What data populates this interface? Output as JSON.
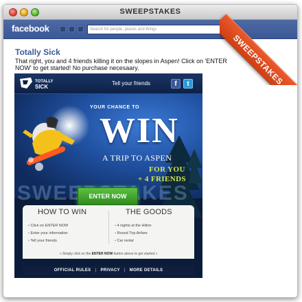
{
  "window": {
    "title": "SWEEPSTAKES"
  },
  "ribbon": {
    "label": "SWEEPSTAKES"
  },
  "facebook": {
    "logo": "facebook",
    "search_placeholder": "Search for people, places and things"
  },
  "page": {
    "title": "Totally Sick",
    "description": "That right, you and 4 friends killing it on the slopes in Aspen! Click on 'ENTER NOW' to get started! No purchase necesaary."
  },
  "app": {
    "logo": "TOTALLY SICK",
    "tell_friends": "Tell your friends",
    "share": {
      "facebook": "f",
      "twitter": "t"
    },
    "hero": {
      "chance": "YOUR CHANCE TO",
      "win": "WIN",
      "trip": "A TRIP TO ASPEN",
      "for_you": "FOR YOU",
      "friends": "+ 4 FRIENDS",
      "ghost_text": "SWEEPSTAKES"
    },
    "enter_button": "ENTER NOW",
    "how_to_win": {
      "title": "HOW TO WIN",
      "items": [
        "Click on ENTER NOW",
        "Enter your information",
        "Tell your friends"
      ]
    },
    "the_goods": {
      "title": "THE GOODS",
      "items": [
        "4 nights at the Hilton",
        "Round Trip Airfare",
        "Car rental"
      ]
    },
    "simply_prefix": "» Simply click on the ",
    "simply_bold": "ENTER NOW",
    "simply_suffix": " button above to get started «",
    "footer": {
      "rules": "OFFICIAL RULES",
      "privacy": "PRIVACY",
      "more": "MORE DETAILS",
      "separator": "|"
    }
  },
  "colors": {
    "facebook_blue": "#3b5998",
    "ribbon": "#e04b20",
    "enter_green": "#3fa22a",
    "accent_yellow": "#d7e84a"
  }
}
